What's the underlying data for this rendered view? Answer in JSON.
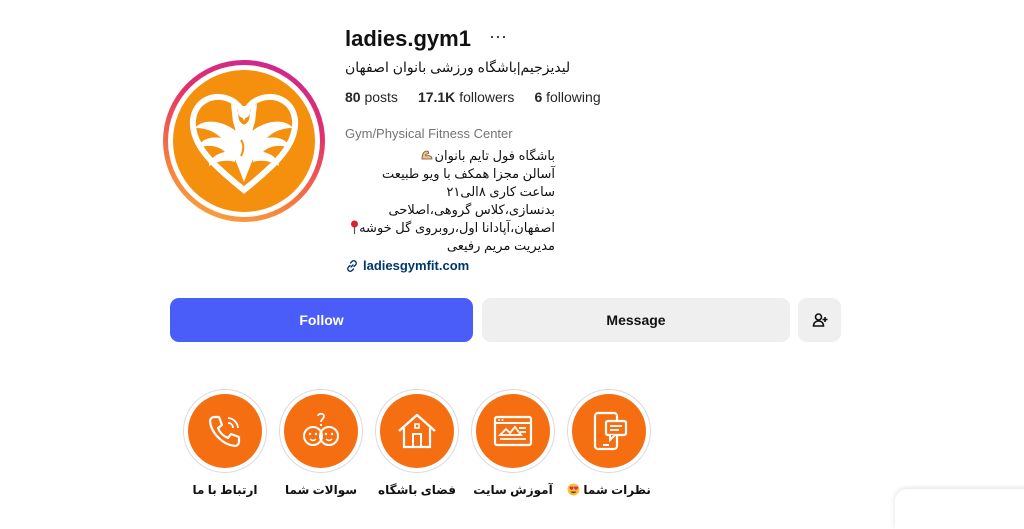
{
  "profile": {
    "username": "ladies.gym1",
    "more_label": "···",
    "full_name": "لیدیزجیم|باشگاه ورزشی بانوان اصفهان",
    "stats": {
      "posts_count": "80",
      "posts_label": "posts",
      "followers_count": "17.1K",
      "followers_label": "followers",
      "following_count": "6",
      "following_label": "following"
    },
    "category": "Gym/Physical Fitness Center",
    "bio": [
      "باشگاه فول تایم بانوان",
      "آسالن مجزا همکف با ویو طبیعت",
      "ساعت کاری ۸الی۲۱",
      "بدنسازی،کلاس گروهی،اصلاحی",
      "اصفهان،آپادانا اول،روبروی گل خوشه",
      "مدیریت مریم رفیعی"
    ],
    "link": "ladiesgymfit.com"
  },
  "actions": {
    "follow_label": "Follow",
    "message_label": "Message",
    "add_user_icon": "person-add-icon"
  },
  "highlights": [
    {
      "label": "نظرات شما",
      "icon": "feedback-phone-icon",
      "emoji": "heart-eyes"
    },
    {
      "label": "آموزش سایت",
      "icon": "website-icon"
    },
    {
      "label": "فضای باشگاه",
      "icon": "house-icon"
    },
    {
      "label": "سوالات شما",
      "icon": "question-faces-icon"
    },
    {
      "label": "ارتباط با ما",
      "icon": "phone-call-icon"
    }
  ],
  "colors": {
    "follow": "#4a5df9",
    "highlight": "#f56f12",
    "avatar_bg": "#f5900f",
    "link": "#00376b"
  }
}
